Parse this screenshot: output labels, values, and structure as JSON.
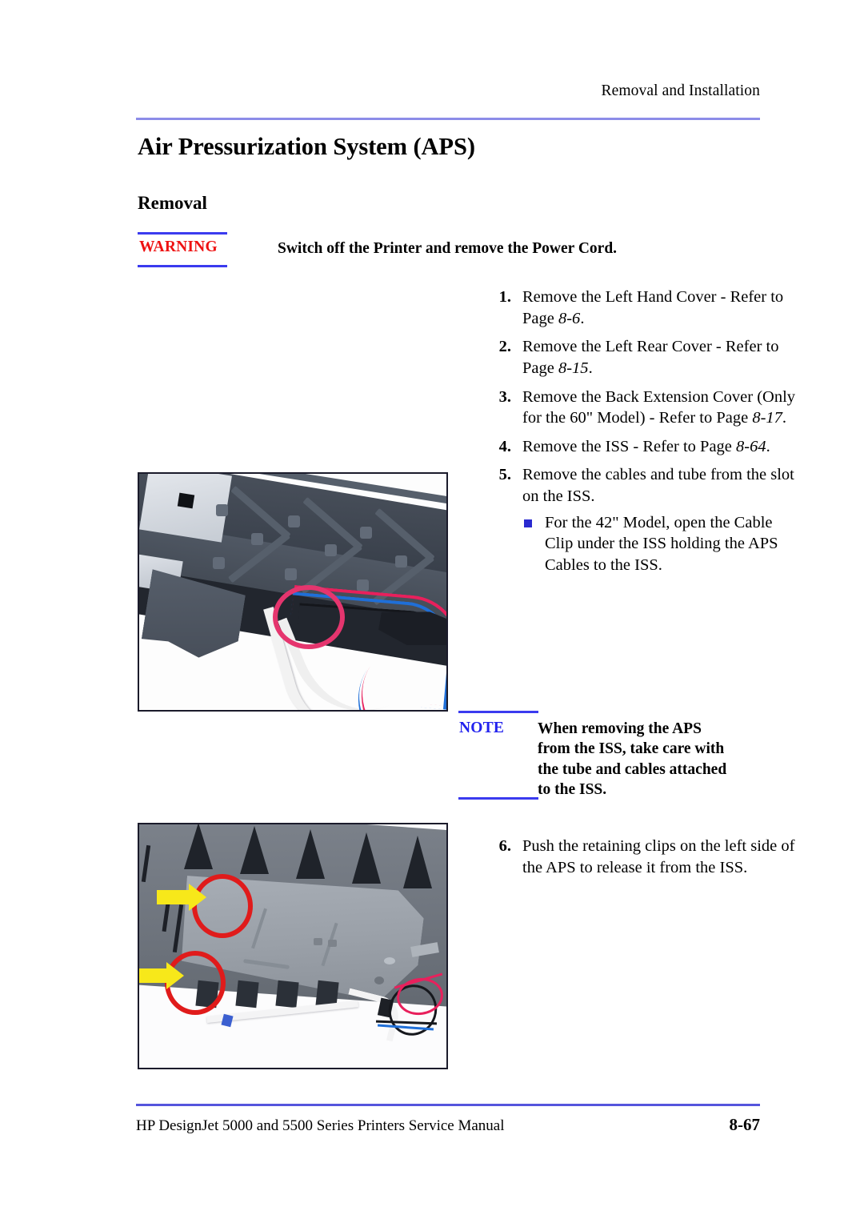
{
  "header": {
    "running_head": "Removal and Installation"
  },
  "titles": {
    "chapter_title": "Air Pressurization System (APS)",
    "section_title": "Removal"
  },
  "warning": {
    "tag": "WARNING",
    "text": "Switch off the Printer and remove the Power Cord.",
    "tag_color": "#ee1111",
    "rule_color": "#3b3bef"
  },
  "note": {
    "tag": "NOTE",
    "line1": "When removing the APS",
    "line2": "from the ISS, take care with",
    "line3": "the tube and cables attached",
    "line4": "to the ISS.",
    "tag_color": "#2222ee",
    "rule_color": "#3b3bef"
  },
  "procedure_top": [
    {
      "num": "1.",
      "text_before": "Remove the Left Hand Cover - Refer to Page ",
      "page_ref": "8-6",
      "text_after": "."
    },
    {
      "num": "2.",
      "text_before": "Remove the Left Rear Cover - Refer to Page ",
      "page_ref": "8-15",
      "text_after": "."
    },
    {
      "num": "3.",
      "text_before": "Remove the Back Extension Cover (Only for the 60\" Model) - Refer to Page ",
      "page_ref": "8-17",
      "text_after": "."
    },
    {
      "num": "4.",
      "text_before": "Remove the ISS - Refer to Page ",
      "page_ref": "8-64",
      "text_after": "."
    },
    {
      "num": "5.",
      "text_before": "Remove the cables and tube from the slot on the ISS.",
      "page_ref": "",
      "text_after": "",
      "bullet": "For the 42\" Model, open the Cable Clip under the ISS holding the APS Cables to the ISS."
    }
  ],
  "procedure_bottom": [
    {
      "num": "6.",
      "text_before": "Push the retaining clips on the left side of the APS to release it from the ISS.",
      "page_ref": "",
      "text_after": ""
    }
  ],
  "figures": {
    "figure_1_caption": "Photograph of ISS slot with APS tube and cables, annotated with a pink circle",
    "figure_2_caption": "Photograph of APS assembly with two red circles and yellow arrows marking retaining clips",
    "annotation_circle_pink": "#e5356e",
    "annotation_circle_red": "#e01b1b",
    "annotation_arrow_yellow": "#f7e81a"
  },
  "footer": {
    "manual_title": "HP DesignJet 5000 and 5500 Series Printers Service Manual",
    "page_number": "8-67",
    "rule_color": "#5555dd"
  },
  "header_rule_color": "#8c8ce8"
}
